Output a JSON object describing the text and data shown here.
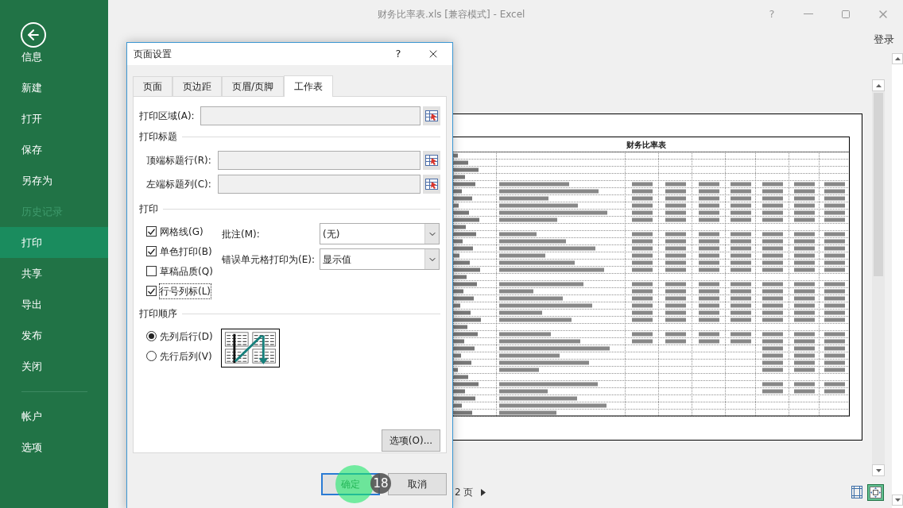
{
  "window": {
    "title": "财务比率表.xls [兼容模式] - Excel",
    "help": "?",
    "sign_in": "登录"
  },
  "sidebar": {
    "items": [
      {
        "label": "信息",
        "selected": false,
        "disabled": false
      },
      {
        "label": "新建",
        "selected": false,
        "disabled": false
      },
      {
        "label": "打开",
        "selected": false,
        "disabled": false
      },
      {
        "label": "保存",
        "selected": false,
        "disabled": false
      },
      {
        "label": "另存为",
        "selected": false,
        "disabled": false
      },
      {
        "label": "历史记录",
        "selected": false,
        "disabled": true
      },
      {
        "label": "打印",
        "selected": true,
        "disabled": false
      },
      {
        "label": "共享",
        "selected": false,
        "disabled": false
      },
      {
        "label": "导出",
        "selected": false,
        "disabled": false
      },
      {
        "label": "发布",
        "selected": false,
        "disabled": false
      },
      {
        "label": "关闭",
        "selected": false,
        "disabled": false
      }
    ],
    "account_items": [
      {
        "label": "帐户",
        "selected": false,
        "disabled": false
      },
      {
        "label": "选项",
        "selected": false,
        "disabled": false
      }
    ]
  },
  "preview": {
    "sheet_title": "财务比率表",
    "page_label": "2 页",
    "show_margins_selected": false,
    "zoom_to_page_selected": true
  },
  "dialog": {
    "title": "页面设置",
    "help": "?",
    "tabs": [
      {
        "label": "页面",
        "selected": false
      },
      {
        "label": "页边距",
        "selected": false
      },
      {
        "label": "页眉/页脚",
        "selected": false
      },
      {
        "label": "工作表",
        "selected": true
      }
    ],
    "print_area": {
      "label": "打印区域(A):"
    },
    "print_titles": {
      "heading": "打印标题",
      "rows": [
        {
          "label": "顶端标题行(R):"
        },
        {
          "label": "左端标题列(C):"
        }
      ]
    },
    "print": {
      "heading": "打印",
      "checkboxes": [
        {
          "label": "网格线(G)",
          "checked": true,
          "focused": false
        },
        {
          "label": "单色打印(B)",
          "checked": true,
          "focused": false
        },
        {
          "label": "草稿品质(Q)",
          "checked": false,
          "focused": false
        },
        {
          "label": "行号列标(L)",
          "checked": true,
          "focused": true
        }
      ],
      "dropdowns": [
        {
          "label": "批注(M):",
          "value": "(无)"
        },
        {
          "label": "错误单元格打印为(E):",
          "value": "显示值"
        }
      ]
    },
    "page_order": {
      "heading": "打印顺序",
      "options": [
        {
          "label": "先列后行(D)",
          "selected": true
        },
        {
          "label": "先行后列(V)",
          "selected": false
        }
      ]
    },
    "options_button": "选项(O)...",
    "ok_button": "确定",
    "cancel_button": "取消",
    "step_badge": "18"
  }
}
